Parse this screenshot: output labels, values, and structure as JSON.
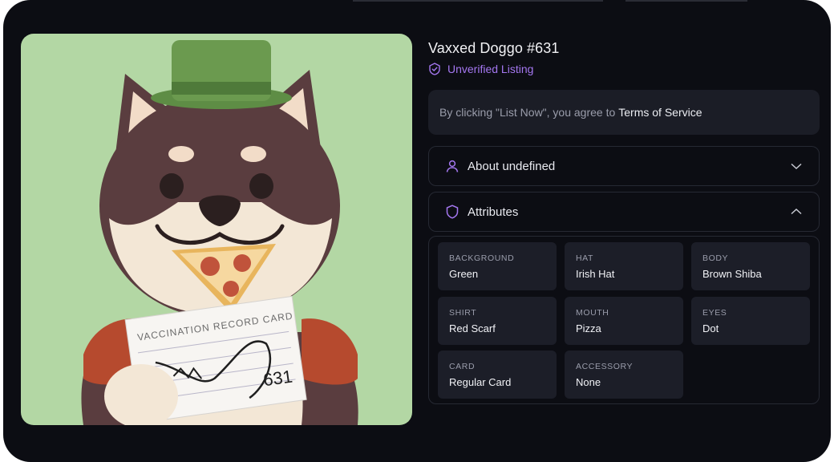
{
  "nft": {
    "title": "Vaxxed Doggo #631",
    "image_alt": "Shiba dog in green hat holding vaccination record card",
    "card_text": "VACCINATION RECORD CARD",
    "card_number": "631"
  },
  "listing_status": {
    "label": "Unverified Listing",
    "icon": "shield-check-icon",
    "color": "#a477f0"
  },
  "terms": {
    "prefix": "By clicking \"List Now\", you agree to",
    "link": "Terms of Service"
  },
  "about": {
    "label": "About undefined",
    "icon": "user-icon",
    "state": "collapsed"
  },
  "attributes": {
    "label": "Attributes",
    "icon": "shield-icon",
    "state": "expanded",
    "items": [
      {
        "key": "BACKGROUND",
        "value": "Green"
      },
      {
        "key": "HAT",
        "value": "Irish Hat"
      },
      {
        "key": "BODY",
        "value": "Brown Shiba"
      },
      {
        "key": "SHIRT",
        "value": "Red Scarf"
      },
      {
        "key": "MOUTH",
        "value": "Pizza"
      },
      {
        "key": "EYES",
        "value": "Dot"
      },
      {
        "key": "CARD",
        "value": "Regular Card"
      },
      {
        "key": "ACCESSORY",
        "value": "None"
      }
    ]
  },
  "colors": {
    "background": "#0c0d13",
    "panel": "#1b1d26",
    "accent": "#a477f0",
    "art_bg": "#b3d7a4"
  }
}
